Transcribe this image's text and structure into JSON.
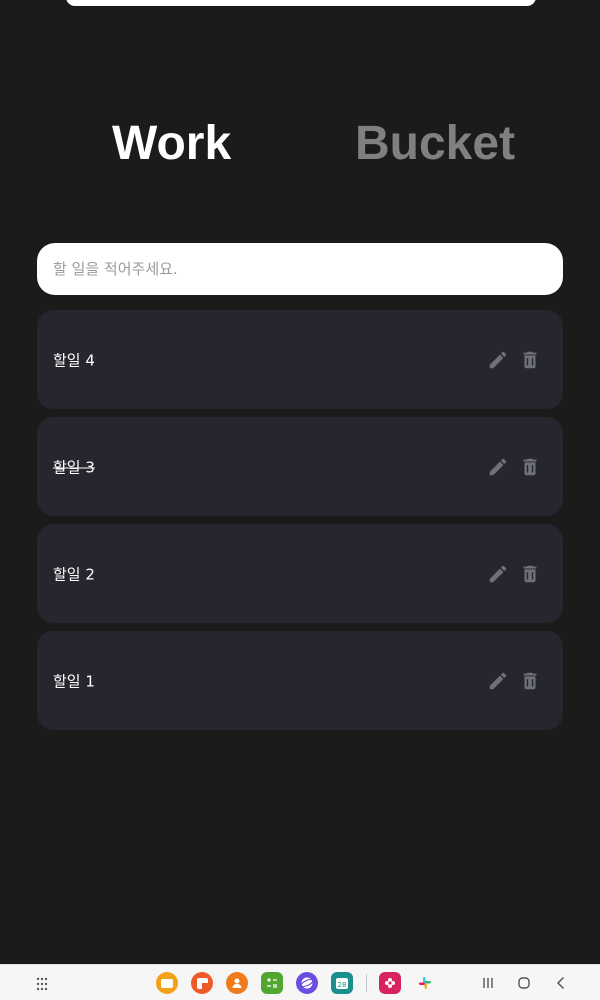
{
  "tabs": [
    {
      "label": "Work",
      "active": true
    },
    {
      "label": "Bucket",
      "active": false
    }
  ],
  "input": {
    "placeholder": "할 일을 적어주세요.",
    "value": ""
  },
  "todos": [
    {
      "text": "할일 4",
      "done": false
    },
    {
      "text": "할일 3",
      "done": true
    },
    {
      "text": "할일 2",
      "done": false
    },
    {
      "text": "할일 1",
      "done": false
    }
  ],
  "icons": {
    "edit": "pencil-icon",
    "delete": "trash-icon"
  },
  "colors": {
    "background": "#1b1b1b",
    "card": "#25262e",
    "active_tab": "#ffffff",
    "inactive_tab": "#808080",
    "icon": "#6f7079"
  },
  "navbar": {
    "dock_apps": [
      "my-files-icon",
      "notes-icon",
      "contacts-icon",
      "calculator-icon",
      "internet-icon",
      "calendar-icon",
      "flower-app-icon",
      "slack-icon"
    ],
    "calendar_day": "28"
  }
}
